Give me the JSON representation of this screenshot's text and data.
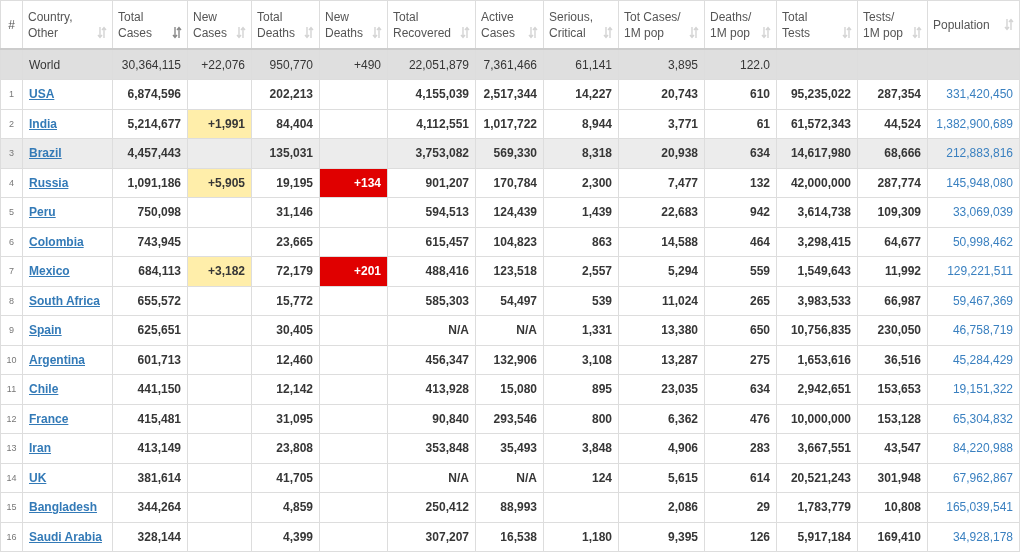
{
  "table": {
    "columns": [
      {
        "kind": "rank",
        "label": [
          "#"
        ]
      },
      {
        "kind": "country",
        "label": [
          "Country,",
          "Other"
        ],
        "sorted": false
      },
      {
        "kind": "number",
        "label": [
          "Total",
          "Cases"
        ],
        "sorted": true
      },
      {
        "kind": "new_cases",
        "label": [
          "New",
          "Cases"
        ],
        "sorted": false
      },
      {
        "kind": "number",
        "label": [
          "Total",
          "Deaths"
        ],
        "sorted": false
      },
      {
        "kind": "new_deaths",
        "label": [
          "New",
          "Deaths"
        ],
        "sorted": false
      },
      {
        "kind": "number",
        "label": [
          "Total",
          "Recovered"
        ],
        "sorted": false
      },
      {
        "kind": "number",
        "label": [
          "Active",
          "Cases"
        ],
        "sorted": false
      },
      {
        "kind": "number",
        "label": [
          "Serious,",
          "Critical"
        ],
        "sorted": false
      },
      {
        "kind": "number",
        "label": [
          "Tot Cases/",
          "1M pop"
        ],
        "sorted": false
      },
      {
        "kind": "number",
        "label": [
          "Deaths/",
          "1M pop"
        ],
        "sorted": false
      },
      {
        "kind": "number",
        "label": [
          "Total",
          "Tests"
        ],
        "sorted": false
      },
      {
        "kind": "number",
        "label": [
          "Tests/",
          "1M pop"
        ],
        "sorted": false
      },
      {
        "kind": "population",
        "label": [
          "Population"
        ],
        "sorted": false
      }
    ],
    "rows": [
      {
        "kind": "total",
        "highlighted": false,
        "cells": [
          null,
          "World",
          "30,364,115",
          "+22,076",
          "950,770",
          "+490",
          "22,051,879",
          "7,361,466",
          "61,141",
          "3,895",
          "122.0",
          null,
          null,
          null
        ]
      },
      {
        "kind": "country",
        "highlighted": false,
        "cells": [
          "1",
          "USA",
          "6,874,596",
          null,
          "202,213",
          null,
          "4,155,039",
          "2,517,344",
          "14,227",
          "20,743",
          "610",
          "95,235,022",
          "287,354",
          "331,420,450"
        ]
      },
      {
        "kind": "country",
        "highlighted": false,
        "cells": [
          "2",
          "India",
          "5,214,677",
          "+1,991",
          "84,404",
          null,
          "4,112,551",
          "1,017,722",
          "8,944",
          "3,771",
          "61",
          "61,572,343",
          "44,524",
          "1,382,900,689"
        ]
      },
      {
        "kind": "country",
        "highlighted": true,
        "cells": [
          "3",
          "Brazil",
          "4,457,443",
          null,
          "135,031",
          null,
          "3,753,082",
          "569,330",
          "8,318",
          "20,938",
          "634",
          "14,617,980",
          "68,666",
          "212,883,816"
        ]
      },
      {
        "kind": "country",
        "highlighted": false,
        "cells": [
          "4",
          "Russia",
          "1,091,186",
          "+5,905",
          "19,195",
          "+134",
          "901,207",
          "170,784",
          "2,300",
          "7,477",
          "132",
          "42,000,000",
          "287,774",
          "145,948,080"
        ]
      },
      {
        "kind": "country",
        "highlighted": false,
        "cells": [
          "5",
          "Peru",
          "750,098",
          null,
          "31,146",
          null,
          "594,513",
          "124,439",
          "1,439",
          "22,683",
          "942",
          "3,614,738",
          "109,309",
          "33,069,039"
        ]
      },
      {
        "kind": "country",
        "highlighted": false,
        "cells": [
          "6",
          "Colombia",
          "743,945",
          null,
          "23,665",
          null,
          "615,457",
          "104,823",
          "863",
          "14,588",
          "464",
          "3,298,415",
          "64,677",
          "50,998,462"
        ]
      },
      {
        "kind": "country",
        "highlighted": false,
        "cells": [
          "7",
          "Mexico",
          "684,113",
          "+3,182",
          "72,179",
          "+201",
          "488,416",
          "123,518",
          "2,557",
          "5,294",
          "559",
          "1,549,643",
          "11,992",
          "129,221,511"
        ]
      },
      {
        "kind": "country",
        "highlighted": false,
        "cells": [
          "8",
          "South Africa",
          "655,572",
          null,
          "15,772",
          null,
          "585,303",
          "54,497",
          "539",
          "11,024",
          "265",
          "3,983,533",
          "66,987",
          "59,467,369"
        ]
      },
      {
        "kind": "country",
        "highlighted": false,
        "cells": [
          "9",
          "Spain",
          "625,651",
          null,
          "30,405",
          null,
          "N/A",
          "N/A",
          "1,331",
          "13,380",
          "650",
          "10,756,835",
          "230,050",
          "46,758,719"
        ]
      },
      {
        "kind": "country",
        "highlighted": false,
        "cells": [
          "10",
          "Argentina",
          "601,713",
          null,
          "12,460",
          null,
          "456,347",
          "132,906",
          "3,108",
          "13,287",
          "275",
          "1,653,616",
          "36,516",
          "45,284,429"
        ]
      },
      {
        "kind": "country",
        "highlighted": false,
        "cells": [
          "11",
          "Chile",
          "441,150",
          null,
          "12,142",
          null,
          "413,928",
          "15,080",
          "895",
          "23,035",
          "634",
          "2,942,651",
          "153,653",
          "19,151,322"
        ]
      },
      {
        "kind": "country",
        "highlighted": false,
        "cells": [
          "12",
          "France",
          "415,481",
          null,
          "31,095",
          null,
          "90,840",
          "293,546",
          "800",
          "6,362",
          "476",
          "10,000,000",
          "153,128",
          "65,304,832"
        ]
      },
      {
        "kind": "country",
        "highlighted": false,
        "cells": [
          "13",
          "Iran",
          "413,149",
          null,
          "23,808",
          null,
          "353,848",
          "35,493",
          "3,848",
          "4,906",
          "283",
          "3,667,551",
          "43,547",
          "84,220,988"
        ]
      },
      {
        "kind": "country",
        "highlighted": false,
        "cells": [
          "14",
          "UK",
          "381,614",
          null,
          "41,705",
          null,
          "N/A",
          "N/A",
          "124",
          "5,615",
          "614",
          "20,521,243",
          "301,948",
          "67,962,867"
        ]
      },
      {
        "kind": "country",
        "highlighted": false,
        "cells": [
          "15",
          "Bangladesh",
          "344,264",
          null,
          "4,859",
          null,
          "250,412",
          "88,993",
          null,
          "2,086",
          "29",
          "1,783,779",
          "10,808",
          "165,039,541"
        ]
      },
      {
        "kind": "country",
        "highlighted": false,
        "cells": [
          "16",
          "Saudi Arabia",
          "328,144",
          null,
          "4,399",
          null,
          "307,207",
          "16,538",
          "1,180",
          "9,395",
          "126",
          "5,917,184",
          "169,410",
          "34,928,178"
        ]
      }
    ]
  }
}
